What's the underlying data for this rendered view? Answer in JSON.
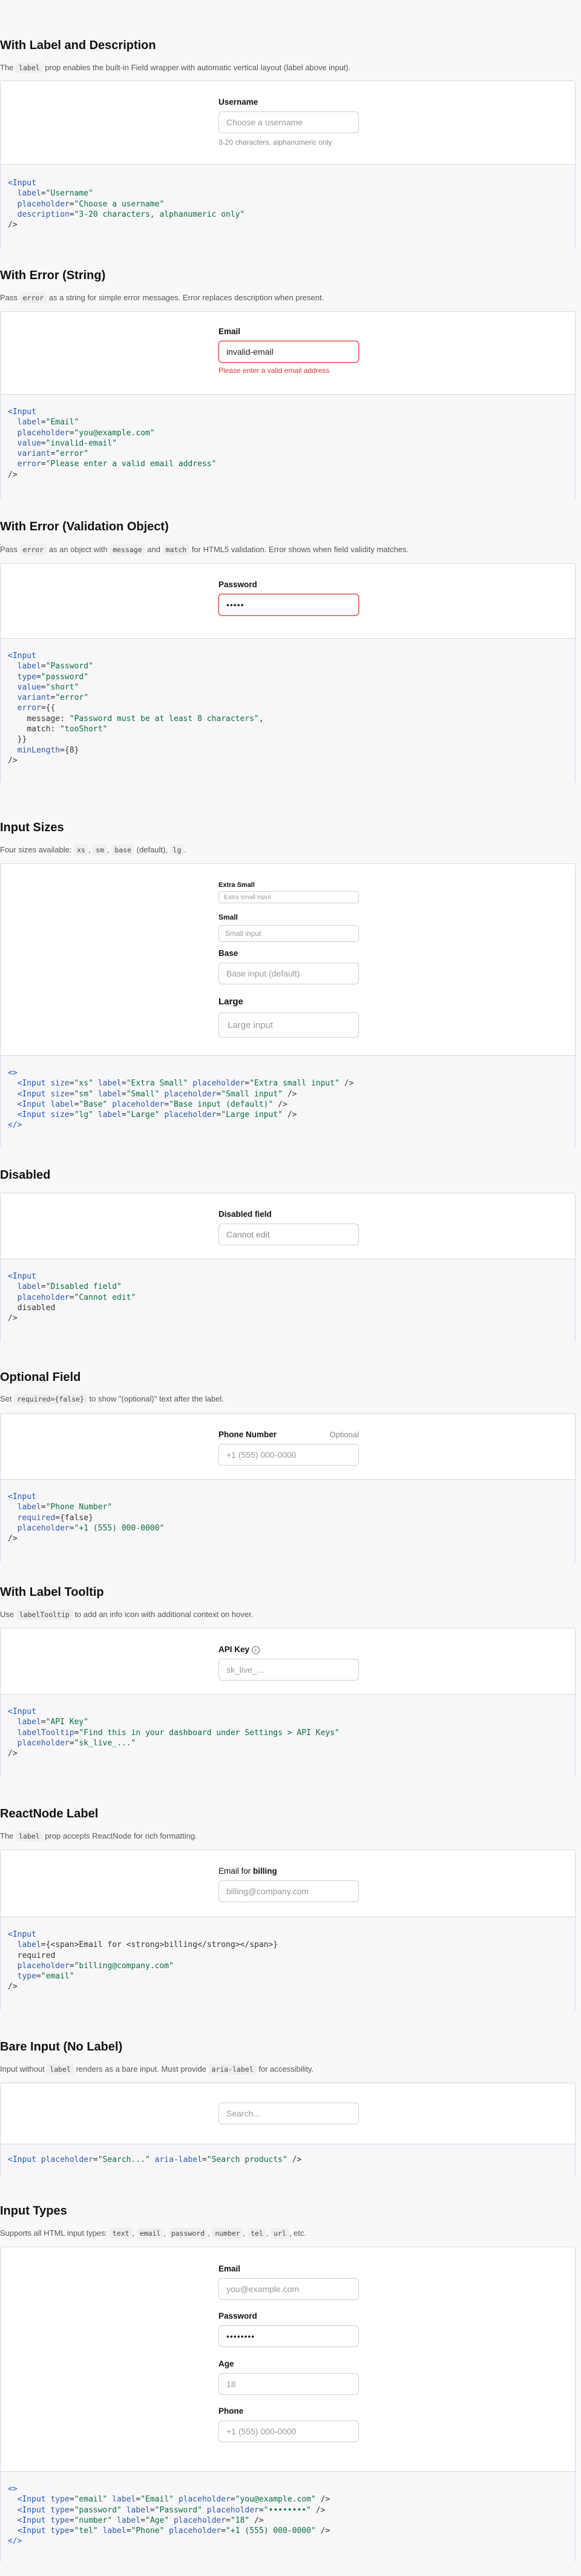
{
  "sections": {
    "label_desc": {
      "title": "With Label and Description",
      "desc_pre": "The ",
      "desc_code": "label",
      "desc_post": " prop enables the built-in Field wrapper with automatic vertical layout (label above input).",
      "field_label": "Username",
      "placeholder": "Choose a username",
      "hint": "3-20 characters, alphanumeric only"
    },
    "error_string": {
      "title": "With Error (String)",
      "desc_pre": "Pass ",
      "desc_code": "error",
      "desc_post": " as a string for simple error messages. Error replaces description when present.",
      "field_label": "Email",
      "value": "invalid-email",
      "error": "Please enter a valid email address"
    },
    "error_object": {
      "title": "With Error (Validation Object)",
      "desc_pre": "Pass ",
      "desc_code": "error",
      "desc_mid1": " as an object with ",
      "desc_code2": "message",
      "desc_mid2": " and ",
      "desc_code3": "match",
      "desc_post": " for HTML5 validation. Error shows when field validity matches.",
      "field_label": "Password",
      "value": "•••••"
    },
    "sizes": {
      "title": "Input Sizes",
      "desc_pre": "Four sizes available: ",
      "desc_code": "xs",
      "desc_sep1": ", ",
      "desc_code2": "sm",
      "desc_sep2": ", ",
      "desc_code3": "base",
      "desc_mid": " (default), ",
      "desc_code4": "lg",
      "desc_post": ".",
      "xs_label": "Extra Small",
      "xs_placeholder": "Extra small input",
      "sm_label": "Small",
      "sm_placeholder": "Small input",
      "base_label": "Base",
      "base_placeholder": "Base input (default)",
      "lg_label": "Large",
      "lg_placeholder": "Large input"
    },
    "disabled": {
      "title": "Disabled",
      "field_label": "Disabled field",
      "placeholder": "Cannot edit"
    },
    "optional": {
      "title": "Optional Field",
      "desc_pre": "Set ",
      "desc_code": "required={false}",
      "desc_post": " to show \"(optional)\" text after the label.",
      "field_label": "Phone Number",
      "optional_text": "Optional",
      "placeholder": "+1 (555) 000-0000"
    },
    "tooltip": {
      "title": "With Label Tooltip",
      "desc_pre": "Use ",
      "desc_code": "labelTooltip",
      "desc_post": " to add an info icon with additional context on hover.",
      "field_label": "API Key",
      "icon_glyph": "i",
      "placeholder": "sk_live_..."
    },
    "reactnode": {
      "title": "ReactNode Label",
      "desc_pre": "The ",
      "desc_code": "label",
      "desc_post": " prop accepts ReactNode for rich formatting.",
      "label_pre": "Email for ",
      "label_strong": "billing",
      "placeholder": "billing@company.com"
    },
    "bare": {
      "title": "Bare Input (No Label)",
      "desc_pre": "Input without ",
      "desc_code": "label",
      "desc_mid": " renders as a bare input. Must provide ",
      "desc_code2": "aria-label",
      "desc_post": " for accessibility.",
      "placeholder": "Search..."
    },
    "types": {
      "title": "Input Types",
      "desc_pre": "Supports all HTML input types: ",
      "desc_code": "text",
      "desc_sep1": ", ",
      "desc_code2": "email",
      "desc_sep2": ", ",
      "desc_code3": "password",
      "desc_sep3": ", ",
      "desc_code4": "number",
      "desc_sep4": ", ",
      "desc_code5": "tel",
      "desc_sep5": ", ",
      "desc_code6": "url",
      "desc_post": ", etc.",
      "email_label": "Email",
      "email_placeholder": "you@example.com",
      "password_label": "Password",
      "password_value": "••••••••",
      "age_label": "Age",
      "age_placeholder": "18",
      "phone_label": "Phone",
      "phone_placeholder": "+1 (555) 000-0000"
    }
  },
  "code": {
    "label_desc": [
      "<Input",
      "  label=\"Username\"",
      "  placeholder=\"Choose a username\"",
      "  description=\"3-20 characters, alphanumeric only\"",
      "/>"
    ],
    "error_string": [
      "<Input",
      "  label=\"Email\"",
      "  placeholder=\"you@example.com\"",
      "  value=\"invalid-email\"",
      "  variant=\"error\"",
      "  error=\"Please enter a valid email address\"",
      "/>"
    ],
    "error_object": [
      "<Input",
      "  label=\"Password\"",
      "  type=\"password\"",
      "  value=\"short\"",
      "  variant=\"error\"",
      "  error={{",
      "    message: \"Password must be at least 8 characters\",",
      "    match: \"tooShort\"",
      "  }}",
      "  minLength={8}",
      "/>"
    ],
    "sizes": [
      "<>",
      "  <Input size=\"xs\" label=\"Extra Small\" placeholder=\"Extra small input\" />",
      "  <Input size=\"sm\" label=\"Small\" placeholder=\"Small input\" />",
      "  <Input label=\"Base\" placeholder=\"Base input (default)\" />",
      "  <Input size=\"lg\" label=\"Large\" placeholder=\"Large input\" />",
      "</>"
    ],
    "disabled": [
      "<Input",
      "  label=\"Disabled field\"",
      "  placeholder=\"Cannot edit\"",
      "  disabled",
      "/>"
    ],
    "optional": [
      "<Input",
      "  label=\"Phone Number\"",
      "  required={false}",
      "  placeholder=\"+1 (555) 000-0000\"",
      "/>"
    ],
    "tooltip": [
      "<Input",
      "  label=\"API Key\"",
      "  labelTooltip=\"Find this in your dashboard under Settings > API Keys\"",
      "  placeholder=\"sk_live_...\"",
      "/>"
    ],
    "reactnode": [
      "<Input",
      "  label={<span>Email for <strong>billing</strong></span>}",
      "  required",
      "  placeholder=\"billing@company.com\"",
      "  type=\"email\"",
      "/>"
    ],
    "bare": [
      "<Input placeholder=\"Search...\" aria-label=\"Search products\" />"
    ],
    "types": [
      "<>",
      "  <Input type=\"email\" label=\"Email\" placeholder=\"you@example.com\" />",
      "  <Input type=\"password\" label=\"Password\" placeholder=\"••••••••\" />",
      "  <Input type=\"number\" label=\"Age\" placeholder=\"18\" />",
      "  <Input type=\"tel\" label=\"Phone\" placeholder=\"+1 (555) 000-0000\" />",
      "</>"
    ]
  }
}
